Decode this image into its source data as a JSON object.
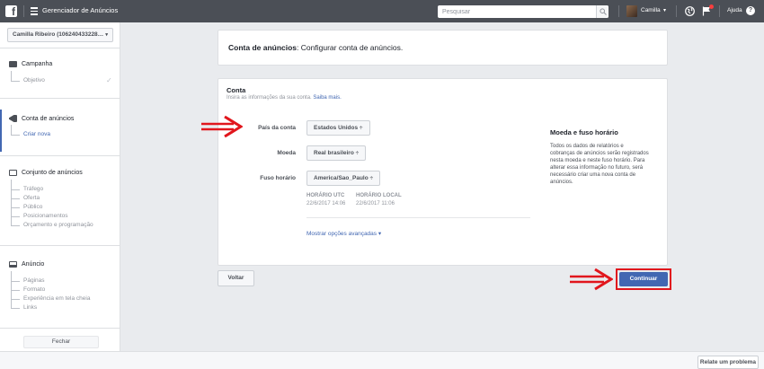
{
  "topbar": {
    "app_title": "Gerenciador de Anúncios",
    "search_placeholder": "Pesquisar",
    "user_name": "Camilla",
    "help_label": "Ajuda",
    "caret": "▾"
  },
  "sidebar": {
    "account_label": "Camilla Ribeiro (106240433228…",
    "sections": {
      "campaign": {
        "title": "Campanha",
        "items": [
          "Objetivo"
        ]
      },
      "ad_account": {
        "title": "Conta de anúncios",
        "items": [
          "Criar nova"
        ]
      },
      "ad_set": {
        "title": "Conjunto de anúncios",
        "items": [
          "Tráfego",
          "Oferta",
          "Público",
          "Posicionamentos",
          "Orçamento e programação"
        ]
      },
      "ad": {
        "title": "Anúncio",
        "items": [
          "Páginas",
          "Formato",
          "Experiência em tela cheia",
          "Links"
        ]
      }
    },
    "close_label": "Fechar"
  },
  "header_card": {
    "title_bold": "Conta de anúncios",
    "title_rest": ": Configurar conta de anúncios."
  },
  "account_form": {
    "title": "Conta",
    "subtitle": "Insira as informações da sua conta.",
    "learn_more": "Saiba mais.",
    "country_label": "País da conta",
    "country_value": "Estados Unidos ÷",
    "currency_label": "Moeda",
    "currency_value": "Real brasileiro ÷",
    "timezone_label": "Fuso horário",
    "timezone_value": "America/Sao_Paulo ÷",
    "utc_head": "HORÁRIO UTC",
    "utc_value": "22/6/2017 14:06",
    "local_head": "HORÁRIO LOCAL",
    "local_value": "22/6/2017 11:06",
    "advanced_link": "Mostrar opções avançadas ▾"
  },
  "info_panel": {
    "title": "Moeda e fuso horário",
    "text": "Todos os dados de relatórios e cobranças de anúncios serão registrados nesta moeda e neste fuso horário. Para alterar essa informação no futuro, será necessário criar uma nova conta de anúncios."
  },
  "actions": {
    "back_label": "Voltar",
    "continue_label": "Continuar"
  },
  "footer": {
    "report_label": "Relate um problema"
  },
  "colors": {
    "topbar": "#4b4f56",
    "accent": "#4267b2",
    "highlight_red": "#e1161d"
  }
}
